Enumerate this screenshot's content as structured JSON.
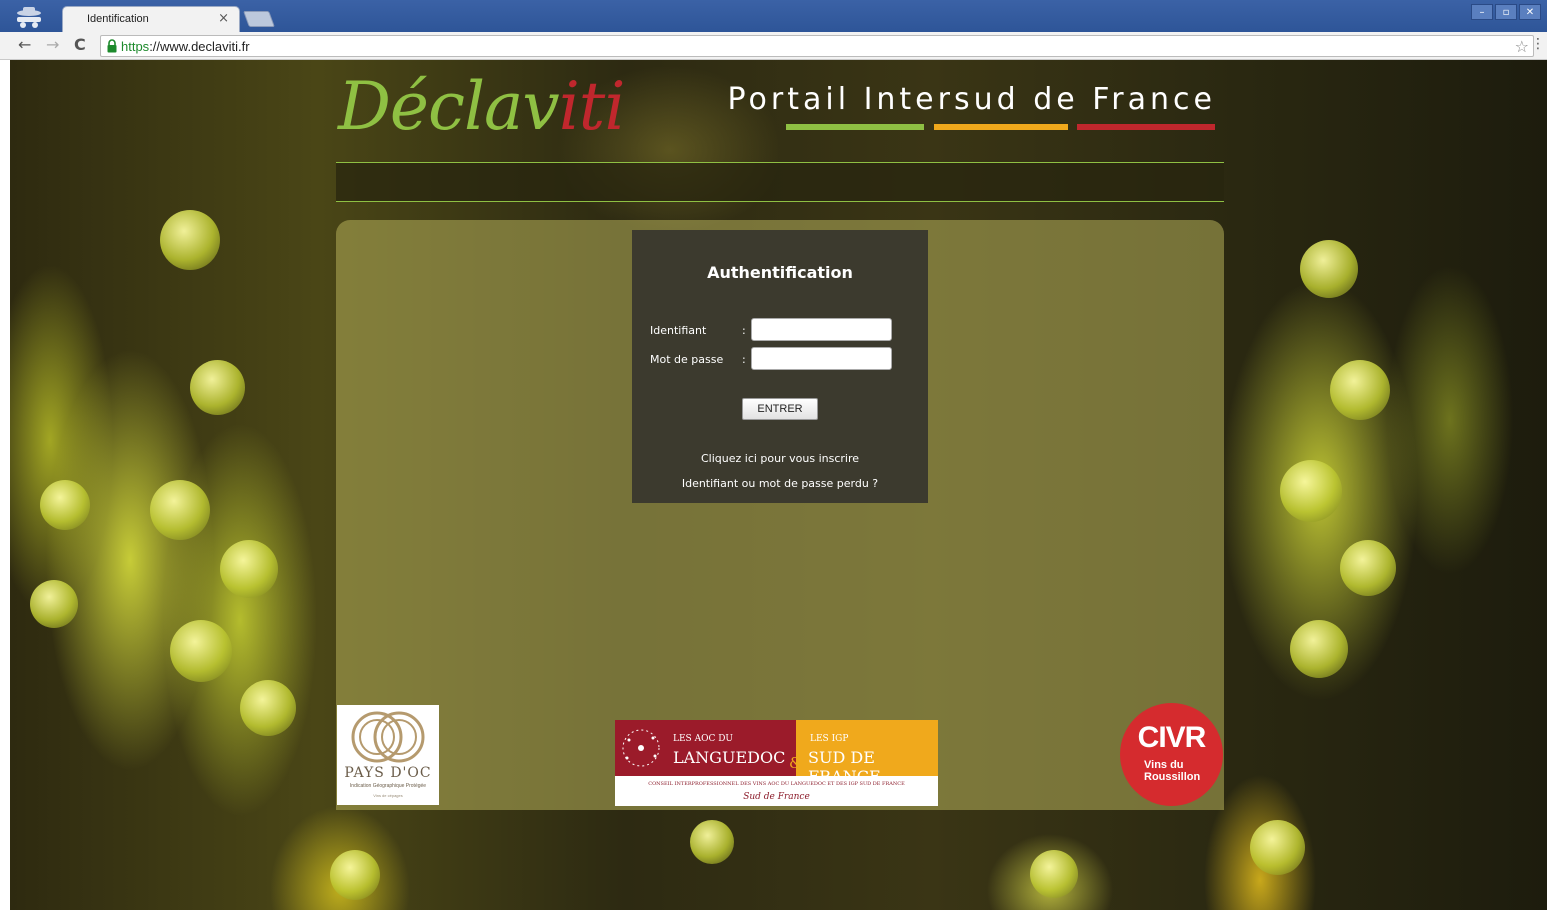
{
  "browser": {
    "tab_title": "Identification",
    "tab_close": "×",
    "url_scheme": "https",
    "url_rest": "://www.declaviti.fr",
    "back": "←",
    "forward": "→",
    "reload": "C",
    "star": "☆",
    "menu": "⋮",
    "win_min": "–",
    "win_max": "▫",
    "win_close": "✕"
  },
  "header": {
    "logo_main": "Déclav",
    "logo_tail": "iti",
    "portal_title": "Portail Intersud de France",
    "accent_colors": [
      "#8fc043",
      "#f0a91c",
      "#c0272d"
    ]
  },
  "auth": {
    "title": "Authentification",
    "username_label": "Identifiant",
    "password_label": "Mot de passe",
    "colon": ":",
    "username_value": "",
    "password_value": "",
    "submit_label": "ENTRER",
    "register_link": "Cliquez ici pour vous inscrire",
    "forgot_link": "Identifiant ou mot de passe perdu ?"
  },
  "partners": {
    "oc": {
      "name": "PAYS D'OC",
      "subtitle": "Indication Géographique Protégée",
      "subtitle2": "Vins de cépages"
    },
    "aoc": {
      "left_small": "LES AOC DU",
      "left_big": "LANGUEDOC",
      "amp": "&",
      "right_small": "LES IGP",
      "right_big": "SUD DE FRANCE",
      "footer": "CONSEIL INTERPROFESSIONNEL DES VINS AOC DU LANGUEDOC ET DES IGP SUD DE FRANCE",
      "sud": "Sud de France"
    },
    "civr": {
      "title": "CIVR",
      "line1": "Vins du",
      "line2": "Roussillon"
    }
  }
}
